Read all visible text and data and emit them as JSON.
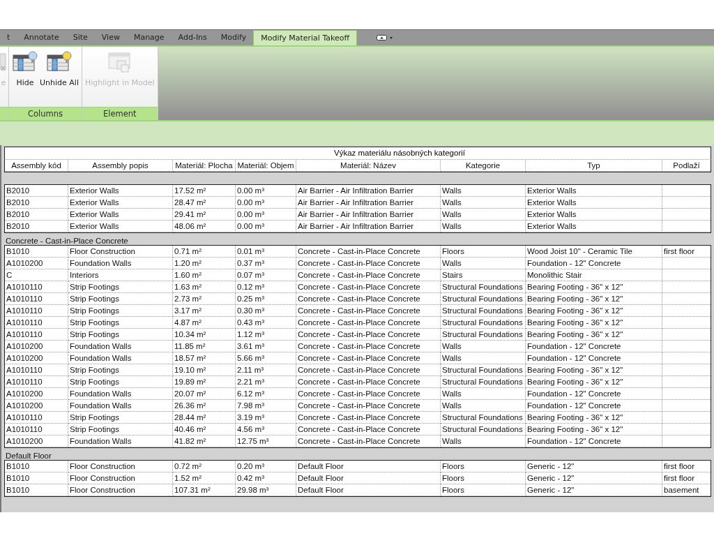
{
  "tabs": [
    {
      "label": "t",
      "selected": false
    },
    {
      "label": "Annotate",
      "selected": false
    },
    {
      "label": "Site",
      "selected": false
    },
    {
      "label": "View",
      "selected": false
    },
    {
      "label": "Manage",
      "selected": false
    },
    {
      "label": "Add-Ins",
      "selected": false
    },
    {
      "label": "Modify",
      "selected": false
    },
    {
      "label": "Modify Material Takeoff",
      "selected": true
    }
  ],
  "ribbon": {
    "panels": [
      {
        "buttons": [
          {
            "label": "e",
            "disabled": true
          }
        ]
      },
      {
        "label": "Columns",
        "buttons": [
          {
            "label": "Hide",
            "disabled": false
          },
          {
            "label": "Unhide All",
            "disabled": false
          }
        ]
      },
      {
        "label": "Element",
        "buttons": [
          {
            "label": "Highlight in Model",
            "disabled": true
          }
        ]
      }
    ]
  },
  "table": {
    "title": "Výkaz materiálu násobných kategorií",
    "columns": [
      "Assembly kód",
      "Assembly popis",
      "Materiál: Plocha",
      "Materiál: Objem",
      "Materiál: Název",
      "Kategorie",
      "Typ",
      "Podlaží"
    ],
    "groups": [
      {
        "rows": [
          {
            "code": "B2010",
            "description": "Exterior Walls",
            "area": "17.52 m²",
            "volume": "0.00 m³",
            "material": "Air Barrier - Air Infiltration Barrier",
            "category": "Walls",
            "type": "Exterior Walls"
          },
          {
            "code": "B2010",
            "description": "Exterior Walls",
            "area": "28.47 m²",
            "volume": "0.00 m³",
            "material": "Air Barrier - Air Infiltration Barrier",
            "category": "Walls",
            "type": "Exterior Walls"
          },
          {
            "code": "B2010",
            "description": "Exterior Walls",
            "area": "29.41 m²",
            "volume": "0.00 m³",
            "material": "Air Barrier - Air Infiltration Barrier",
            "category": "Walls",
            "type": "Exterior Walls"
          },
          {
            "code": "B2010",
            "description": "Exterior Walls",
            "area": "48.06 m²",
            "volume": "0.00 m³",
            "material": "Air Barrier - Air Infiltration Barrier",
            "category": "Walls",
            "type": "Exterior Walls"
          }
        ]
      },
      {
        "header": "Concrete - Cast-in-Place Concrete",
        "rows": [
          {
            "code": "B1010",
            "description": "Floor Construction",
            "area": "0.71 m²",
            "volume": "0.01 m³",
            "material": "Concrete - Cast-in-Place Concrete",
            "category": "Floors",
            "type": "Wood Joist 10\" - Ceramic Tile",
            "floor": "first floor"
          },
          {
            "code": "A1010200",
            "description": "Foundation Walls",
            "area": "1.20 m²",
            "volume": "0.37 m³",
            "material": "Concrete - Cast-in-Place Concrete",
            "category": "Walls",
            "type": "Foundation - 12\" Concrete"
          },
          {
            "code": "C",
            "description": "Interiors",
            "area": "1.60 m²",
            "volume": "0.07 m³",
            "material": "Concrete - Cast-in-Place Concrete",
            "category": "Stairs",
            "type": "Monolithic Stair"
          },
          {
            "code": "A1010110",
            "description": "Strip Footings",
            "area": "1.63 m²",
            "volume": "0.12 m³",
            "material": "Concrete - Cast-in-Place Concrete",
            "category": "Structural Foundations",
            "type": "Bearing Footing - 36\" x 12\""
          },
          {
            "code": "A1010110",
            "description": "Strip Footings",
            "area": "2.73 m²",
            "volume": "0.25 m³",
            "material": "Concrete - Cast-in-Place Concrete",
            "category": "Structural Foundations",
            "type": "Bearing Footing - 36\" x 12\""
          },
          {
            "code": "A1010110",
            "description": "Strip Footings",
            "area": "3.17 m²",
            "volume": "0.30 m³",
            "material": "Concrete - Cast-in-Place Concrete",
            "category": "Structural Foundations",
            "type": "Bearing Footing - 36\" x 12\""
          },
          {
            "code": "A1010110",
            "description": "Strip Footings",
            "area": "4.87 m²",
            "volume": "0.43 m³",
            "material": "Concrete - Cast-in-Place Concrete",
            "category": "Structural Foundations",
            "type": "Bearing Footing - 36\" x 12\""
          },
          {
            "code": "A1010110",
            "description": "Strip Footings",
            "area": "10.34 m²",
            "volume": "1.12 m³",
            "material": "Concrete - Cast-in-Place Concrete",
            "category": "Structural Foundations",
            "type": "Bearing Footing - 36\" x 12\""
          },
          {
            "code": "A1010200",
            "description": "Foundation Walls",
            "area": "11.85 m²",
            "volume": "3.61 m³",
            "material": "Concrete - Cast-in-Place Concrete",
            "category": "Walls",
            "type": "Foundation - 12\" Concrete"
          },
          {
            "code": "A1010200",
            "description": "Foundation Walls",
            "area": "18.57 m²",
            "volume": "5.66 m³",
            "material": "Concrete - Cast-in-Place Concrete",
            "category": "Walls",
            "type": "Foundation - 12\" Concrete"
          },
          {
            "code": "A1010110",
            "description": "Strip Footings",
            "area": "19.10 m²",
            "volume": "2.11 m³",
            "material": "Concrete - Cast-in-Place Concrete",
            "category": "Structural Foundations",
            "type": "Bearing Footing - 36\" x 12\""
          },
          {
            "code": "A1010110",
            "description": "Strip Footings",
            "area": "19.89 m²",
            "volume": "2.21 m³",
            "material": "Concrete - Cast-in-Place Concrete",
            "category": "Structural Foundations",
            "type": "Bearing Footing - 36\" x 12\""
          },
          {
            "code": "A1010200",
            "description": "Foundation Walls",
            "area": "20.07 m²",
            "volume": "6.12 m³",
            "material": "Concrete - Cast-in-Place Concrete",
            "category": "Walls",
            "type": "Foundation - 12\" Concrete"
          },
          {
            "code": "A1010200",
            "description": "Foundation Walls",
            "area": "26.36 m²",
            "volume": "7.98 m³",
            "material": "Concrete - Cast-in-Place Concrete",
            "category": "Walls",
            "type": "Foundation - 12\" Concrete"
          },
          {
            "code": "A1010110",
            "description": "Strip Footings",
            "area": "28.44 m²",
            "volume": "3.19 m³",
            "material": "Concrete - Cast-in-Place Concrete",
            "category": "Structural Foundations",
            "type": "Bearing Footing - 36\" x 12\""
          },
          {
            "code": "A1010110",
            "description": "Strip Footings",
            "area": "40.46 m²",
            "volume": "4.56 m³",
            "material": "Concrete - Cast-in-Place Concrete",
            "category": "Structural Foundations",
            "type": "Bearing Footing - 36\" x 12\""
          },
          {
            "code": "A1010200",
            "description": "Foundation Walls",
            "area": "41.82 m²",
            "volume": "12.75 m³",
            "material": "Concrete - Cast-in-Place Concrete",
            "category": "Walls",
            "type": "Foundation - 12\" Concrete"
          }
        ]
      },
      {
        "header": "Default Floor",
        "rows": [
          {
            "code": "B1010",
            "description": "Floor Construction",
            "area": "0.72 m²",
            "volume": "0.20 m³",
            "material": "Default Floor",
            "category": "Floors",
            "type": "Generic - 12\"",
            "floor": "first floor"
          },
          {
            "code": "B1010",
            "description": "Floor Construction",
            "area": "1.52 m²",
            "volume": "0.42 m³",
            "material": "Default Floor",
            "category": "Floors",
            "type": "Generic - 12\"",
            "floor": "first floor"
          },
          {
            "code": "B1010",
            "description": "Floor Construction",
            "area": "107.31 m²",
            "volume": "29.98 m³",
            "material": "Default Floor",
            "category": "Floors",
            "type": "Generic - 12\"",
            "floor": "basement"
          }
        ]
      }
    ]
  }
}
